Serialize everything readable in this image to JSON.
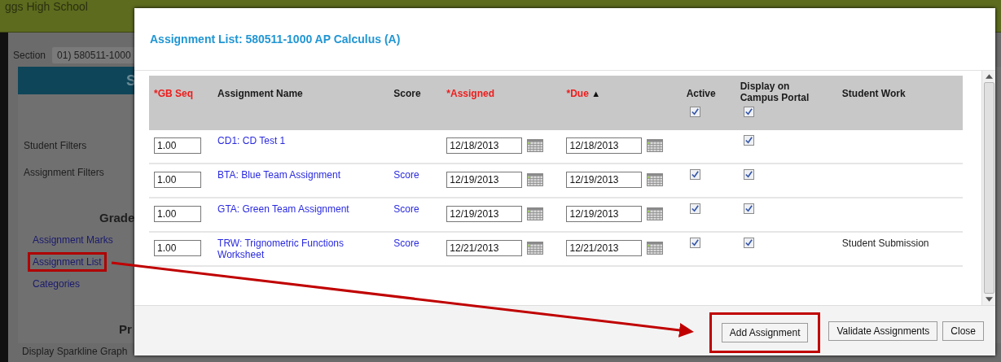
{
  "background": {
    "header_title": "ggs High School",
    "section_label": "Section",
    "section_value": "01) 580511-1000",
    "banner_text": "S",
    "filters": [
      "Student Filters",
      "Assignment Filters"
    ],
    "grade_heading": "Grade",
    "links": [
      {
        "label": "Assignment Marks",
        "highlighted": false
      },
      {
        "label": "Assignment List",
        "highlighted": true
      },
      {
        "label": "Categories",
        "highlighted": false
      }
    ],
    "preferences_heading": "Pr",
    "sparkline_label": "Display Sparkline Graph"
  },
  "modal": {
    "title": "Assignment List: 580511-1000 AP Calculus (A)",
    "columns": [
      {
        "label": "*GB Seq",
        "required": true,
        "sorted": false
      },
      {
        "label": "Assignment Name",
        "required": false,
        "sorted": false
      },
      {
        "label": "Score",
        "required": false,
        "sorted": false
      },
      {
        "label": "*Assigned",
        "required": true,
        "sorted": false
      },
      {
        "label": "*Due",
        "required": true,
        "sorted": true
      },
      {
        "label": "Active",
        "required": false,
        "sorted": false,
        "all_checked": true
      },
      {
        "label": "Display on Campus Portal",
        "required": false,
        "sorted": false,
        "all_checked": true
      },
      {
        "label": "Student Work",
        "required": false,
        "sorted": false
      }
    ],
    "sort_arrow": "▲",
    "rows": [
      {
        "seq": "1.00",
        "name": "CD1: CD Test 1",
        "assigned": "12/18/2013",
        "due": "12/18/2013",
        "portal": true
      },
      {
        "seq": "1.00",
        "name": "BTA: Blue Team Assignment",
        "score": "Score",
        "assigned": "12/19/2013",
        "due": "12/19/2013",
        "active": true,
        "portal": true
      },
      {
        "seq": "1.00",
        "name": "GTA: Green Team Assignment",
        "score": "Score",
        "assigned": "12/19/2013",
        "due": "12/19/2013",
        "active": true,
        "portal": true
      },
      {
        "seq": "1.00",
        "name": "TRW: Trignometric Functions Worksheet",
        "score": "Score",
        "assigned": "12/21/2013",
        "due": "12/21/2013",
        "active": true,
        "portal": true,
        "student_work": "Student Submission"
      }
    ],
    "buttons": [
      {
        "label": "Add Assignment",
        "highlighted": true
      },
      {
        "label": "Validate Assignments",
        "highlighted": false
      },
      {
        "label": "Close",
        "highlighted": false
      }
    ]
  },
  "annotation_arrow": true
}
